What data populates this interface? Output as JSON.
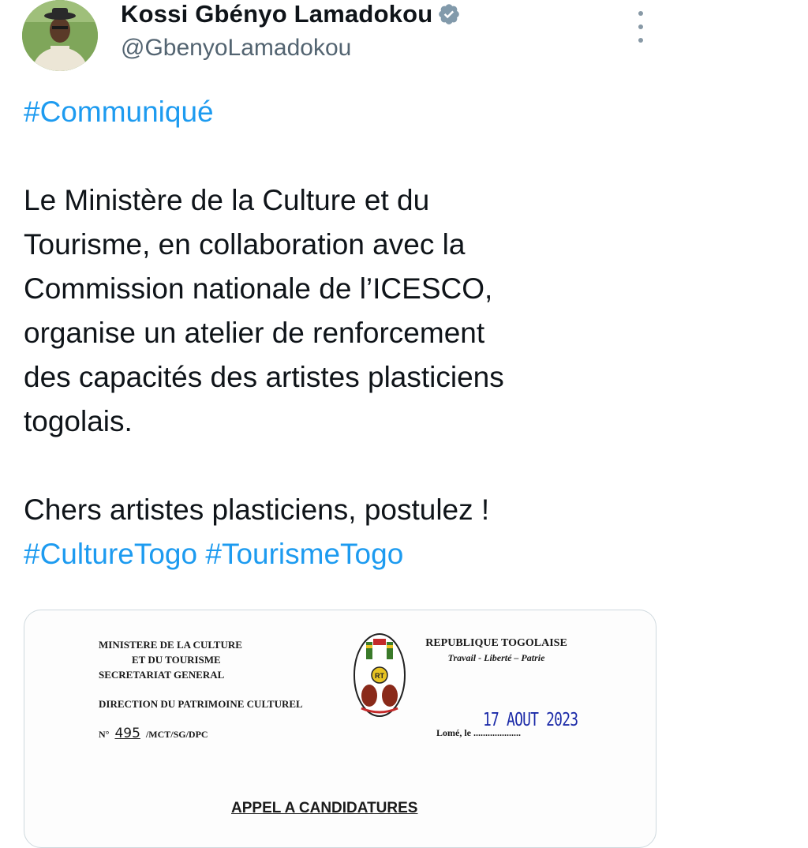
{
  "author": {
    "display_name": "Kossi Gbényo Lamadokou",
    "handle": "@GbenyoLamadokou",
    "verified_icon": "verified-badge-icon",
    "avatar_icon": "profile-photo"
  },
  "more_menu_icon": "more-vertical-icon",
  "tweet": {
    "hashtag_communique": "#Communiqué",
    "body_line_1": "Le Ministère de la Culture et du",
    "body_line_2": "Tourisme, en collaboration avec la",
    "body_line_3": "Commission nationale de l’ICESCO,",
    "body_line_4": "organise un atelier de renforcement",
    "body_line_5": "des capacités des artistes plasticiens",
    "body_line_6": "togolais.",
    "call_to_action": "Chers artistes plasticiens, postulez !",
    "hashtag_culture": "#CultureTogo",
    "hashtag_tourisme": "#TourismeTogo"
  },
  "media": {
    "ministry_line_1": "MINISTERE DE LA CULTURE",
    "ministry_line_2": "ET DU TOURISME",
    "ministry_line_3": "SECRETARIAT GENERAL",
    "direction": "DIRECTION DU PATRIMOINE CULTUREL",
    "number_prefix": "N°",
    "number_value": "495",
    "number_suffix": "/MCT/SG/DPC",
    "republic": "REPUBLIQUE TOGOLAISE",
    "motto": "Travail - Liberté – Patrie",
    "lome_label": "Lomé, le ....................",
    "date_stamp": "17 AOUT 2023",
    "heading": "APPEL A CANDIDATURES",
    "emblem_letters": "RT"
  },
  "colors": {
    "hashtag": "#1d9bf0",
    "text": "#0f1419",
    "secondary_text": "#536471",
    "verified_badge": "#829aab",
    "stamp_ink": "#1b2aa8"
  }
}
